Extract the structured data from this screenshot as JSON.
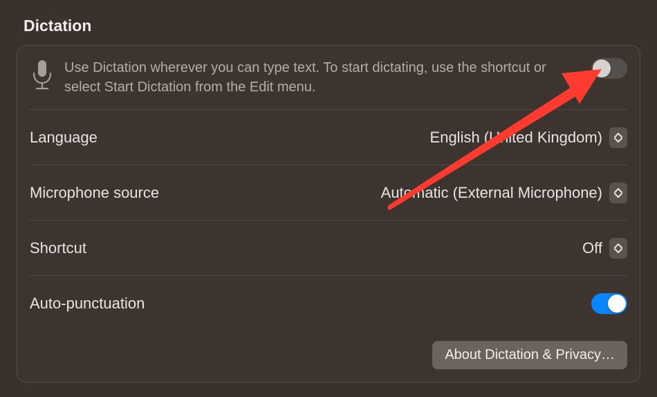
{
  "section_title": "Dictation",
  "intro_text": "Use Dictation wherever you can type text. To start dictating, use the shortcut or select Start Dictation from the Edit menu.",
  "dictation_toggle": {
    "on": false
  },
  "rows": {
    "language": {
      "label": "Language",
      "value": "English (United Kingdom)"
    },
    "mic_source": {
      "label": "Microphone source",
      "value": "Automatic (External Microphone)"
    },
    "shortcut": {
      "label": "Shortcut",
      "value": "Off"
    },
    "auto_punct": {
      "label": "Auto-punctuation",
      "toggle_on": true
    }
  },
  "about_button": "About Dictation & Privacy…",
  "colors": {
    "accent": "#0a84ff",
    "arrow": "#ff3b30"
  }
}
